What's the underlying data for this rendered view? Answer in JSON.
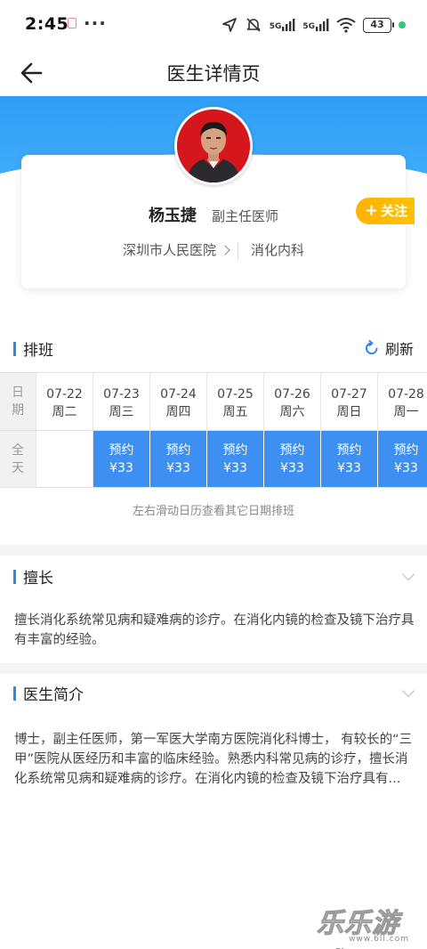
{
  "status_bar": {
    "time": "2:45",
    "dots": "···",
    "network1": "5G",
    "network2": "5G",
    "battery": "43"
  },
  "nav": {
    "title": "医生详情页"
  },
  "doctor": {
    "name": "杨玉捷",
    "title": "副主任医师",
    "hospital": "深圳市人民医院",
    "department": "消化内科",
    "follow_label": "关注"
  },
  "schedule": {
    "section_title": "排班",
    "refresh_label": "刷新",
    "row_date_label": "日期",
    "row_allday_label": "全天",
    "days": [
      {
        "date": "07-22",
        "weekday": "周二",
        "slot": null
      },
      {
        "date": "07-23",
        "weekday": "周三",
        "slot": {
          "label": "预约",
          "price": "¥33"
        }
      },
      {
        "date": "07-24",
        "weekday": "周四",
        "slot": {
          "label": "预约",
          "price": "¥33"
        }
      },
      {
        "date": "07-25",
        "weekday": "周五",
        "slot": {
          "label": "预约",
          "price": "¥33"
        }
      },
      {
        "date": "07-26",
        "weekday": "周六",
        "slot": {
          "label": "预约",
          "price": "¥33"
        }
      },
      {
        "date": "07-27",
        "weekday": "周日",
        "slot": {
          "label": "预约",
          "price": "¥33"
        }
      },
      {
        "date": "07-28",
        "weekday": "周一",
        "slot": {
          "label": "预约",
          "price": "¥33"
        }
      }
    ],
    "hint": "左右滑动日历查看其它日期排班"
  },
  "specialty": {
    "section_title": "擅长",
    "text": "擅长消化系统常见病和疑难病的诊疗。在消化内镜的检查及镜下治疗具有丰富的经验。"
  },
  "intro": {
    "section_title": "医生简介",
    "text": "博士，副主任医师，第一军医大学南方医院消化科博士， 有较长的“三甲”医院从医经历和丰富的临床经验。熟悉内科常见病的诊疗，擅长消化系统常见病和疑难病的诊疗。在消化内镜的检查及镜下治疗具有..."
  },
  "watermark": {
    "text": "乐乐游戏",
    "url": "www.6ll.com"
  },
  "colors": {
    "primary_blue": "#2f86f6",
    "slot_blue": "#3e8ff2",
    "follow_orange": "#ffb300"
  }
}
